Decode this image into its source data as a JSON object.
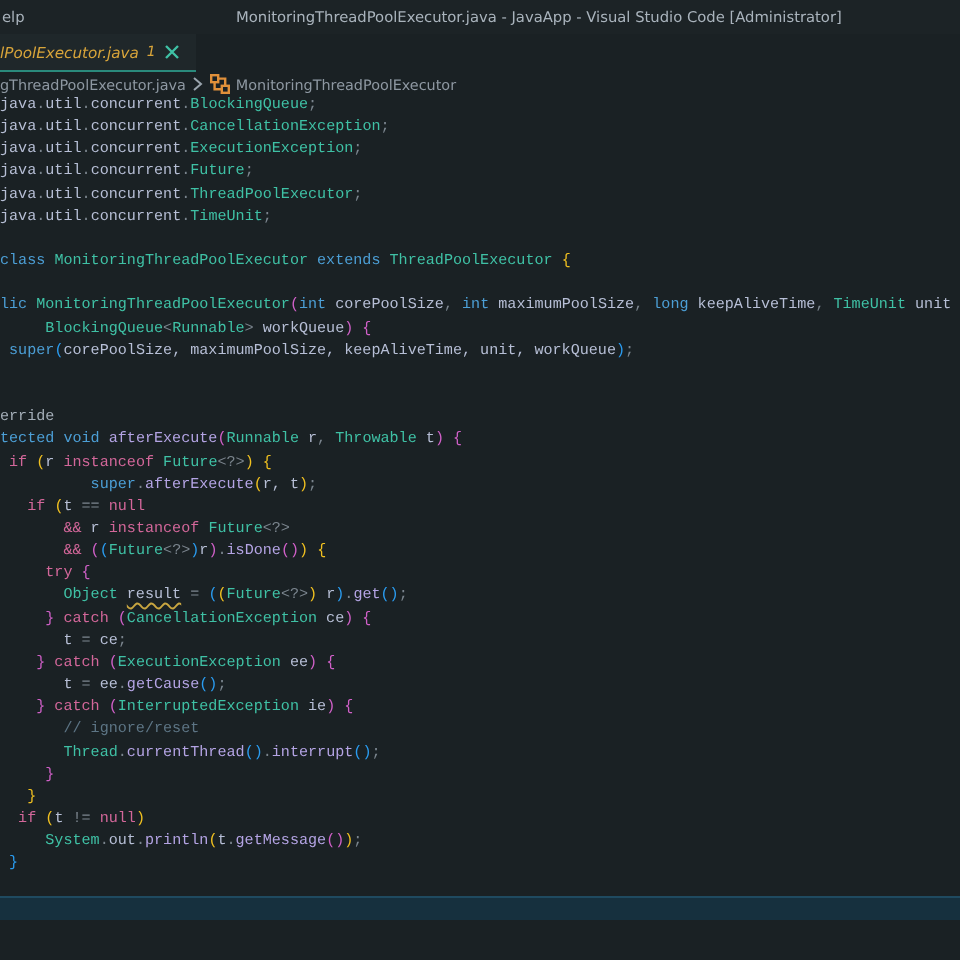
{
  "title_bar": {
    "menu_items": [
      "elp"
    ],
    "title": "MonitoringThreadPoolExecutor.java - JavaApp - Visual Studio Code [Administrator]"
  },
  "tabs": [
    {
      "label": "lPoolExecutor.java",
      "problems": "1",
      "selected": true
    }
  ],
  "breadcrumb": {
    "file": "gThreadPoolExecutor.java",
    "symbol": "MonitoringThreadPoolExecutor"
  },
  "code_lines": [
    {
      "tokens": [
        {
          "kind": "identifier",
          "text": "java"
        },
        {
          "kind": "punctuation",
          "text": "."
        },
        {
          "kind": "identifier",
          "text": "util"
        },
        {
          "kind": "punctuation",
          "text": "."
        },
        {
          "kind": "identifier",
          "text": "concurrent"
        },
        {
          "kind": "punctuation",
          "text": "."
        },
        {
          "kind": "type",
          "text": "BlockingQueue"
        },
        {
          "kind": "punctuation",
          "text": ";"
        }
      ]
    },
    {
      "tokens": [
        {
          "kind": "identifier",
          "text": "java"
        },
        {
          "kind": "punctuation",
          "text": "."
        },
        {
          "kind": "identifier",
          "text": "util"
        },
        {
          "kind": "punctuation",
          "text": "."
        },
        {
          "kind": "identifier",
          "text": "concurrent"
        },
        {
          "kind": "punctuation",
          "text": "."
        },
        {
          "kind": "type",
          "text": "CancellationException"
        },
        {
          "kind": "punctuation",
          "text": ";"
        }
      ]
    },
    {
      "tokens": [
        {
          "kind": "identifier",
          "text": "java"
        },
        {
          "kind": "punctuation",
          "text": "."
        },
        {
          "kind": "identifier",
          "text": "util"
        },
        {
          "kind": "punctuation",
          "text": "."
        },
        {
          "kind": "identifier",
          "text": "concurrent"
        },
        {
          "kind": "punctuation",
          "text": "."
        },
        {
          "kind": "type",
          "text": "ExecutionException"
        },
        {
          "kind": "punctuation",
          "text": ";"
        }
      ]
    },
    {
      "tokens": [
        {
          "kind": "identifier",
          "text": "java"
        },
        {
          "kind": "punctuation",
          "text": "."
        },
        {
          "kind": "identifier",
          "text": "util"
        },
        {
          "kind": "punctuation",
          "text": "."
        },
        {
          "kind": "identifier",
          "text": "concurrent"
        },
        {
          "kind": "punctuation",
          "text": "."
        },
        {
          "kind": "type",
          "text": "Future"
        },
        {
          "kind": "punctuation",
          "text": ";"
        }
      ]
    },
    {
      "tokens": [
        {
          "kind": "identifier",
          "text": "java"
        },
        {
          "kind": "punctuation",
          "text": "."
        },
        {
          "kind": "identifier",
          "text": "util"
        },
        {
          "kind": "punctuation",
          "text": "."
        },
        {
          "kind": "identifier",
          "text": "concurrent"
        },
        {
          "kind": "punctuation",
          "text": "."
        },
        {
          "kind": "type",
          "text": "ThreadPoolExecutor"
        },
        {
          "kind": "punctuation",
          "text": ";"
        }
      ]
    },
    {
      "tokens": [
        {
          "kind": "identifier",
          "text": "java"
        },
        {
          "kind": "punctuation",
          "text": "."
        },
        {
          "kind": "identifier",
          "text": "util"
        },
        {
          "kind": "punctuation",
          "text": "."
        },
        {
          "kind": "identifier",
          "text": "concurrent"
        },
        {
          "kind": "punctuation",
          "text": "."
        },
        {
          "kind": "type",
          "text": "TimeUnit"
        },
        {
          "kind": "punctuation",
          "text": ";"
        }
      ]
    },
    {
      "kind": "blank"
    },
    {
      "tokens": [
        {
          "kind": "storage",
          "text": "class "
        },
        {
          "kind": "type",
          "text": "MonitoringThreadPoolExecutor"
        },
        {
          "kind": "storage",
          "text": " extends "
        },
        {
          "kind": "type",
          "text": "ThreadPoolExecutor"
        },
        {
          "kind": "bracket-gold",
          "text": " {"
        }
      ]
    },
    {
      "kind": "blank"
    },
    {
      "tokens": [
        {
          "kind": "storage",
          "text": "lic "
        },
        {
          "kind": "type",
          "text": "MonitoringThreadPoolExecutor"
        },
        {
          "kind": "bracket-violet",
          "text": "("
        },
        {
          "kind": "storage",
          "text": "int "
        },
        {
          "kind": "identifier",
          "text": "corePoolSize"
        },
        {
          "kind": "punctuation",
          "text": ", "
        },
        {
          "kind": "storage",
          "text": "int "
        },
        {
          "kind": "identifier",
          "text": "maximumPoolSize"
        },
        {
          "kind": "punctuation",
          "text": ", "
        },
        {
          "kind": "storage",
          "text": "long "
        },
        {
          "kind": "identifier",
          "text": "keepAliveTime"
        },
        {
          "kind": "punctuation",
          "text": ", "
        },
        {
          "kind": "type",
          "text": "TimeUnit "
        },
        {
          "kind": "identifier",
          "text": "unit"
        }
      ]
    },
    {
      "tokens": [
        {
          "kind": "type",
          "text": "     BlockingQueue"
        },
        {
          "kind": "punctuation",
          "text": "<"
        },
        {
          "kind": "type",
          "text": "Runnable"
        },
        {
          "kind": "punctuation",
          "text": ">"
        },
        {
          "kind": "identifier",
          "text": " workQueue"
        },
        {
          "kind": "bracket-violet",
          "text": ")"
        },
        {
          "kind": "bracket-violet",
          "text": " {"
        }
      ]
    },
    {
      "tokens": [
        {
          "kind": "storage",
          "text": " super"
        },
        {
          "kind": "bracket-blue",
          "text": "("
        },
        {
          "kind": "identifier",
          "text": "corePoolSize, maximumPoolSize, keepAliveTime, unit, workQueue"
        },
        {
          "kind": "bracket-blue",
          "text": ")"
        },
        {
          "kind": "punctuation",
          "text": ";"
        }
      ]
    },
    {
      "kind": "blank"
    },
    {
      "kind": "blank"
    },
    {
      "tokens": [
        {
          "kind": "annotation",
          "text": "erride"
        }
      ]
    },
    {
      "tokens": [
        {
          "kind": "storage",
          "text": "tected void "
        },
        {
          "kind": "method",
          "text": "afterExecute"
        },
        {
          "kind": "bracket-violet",
          "text": "("
        },
        {
          "kind": "type",
          "text": "Runnable"
        },
        {
          "kind": "identifier",
          "text": " r"
        },
        {
          "kind": "punctuation",
          "text": ", "
        },
        {
          "kind": "type",
          "text": "Throwable"
        },
        {
          "kind": "identifier",
          "text": " t"
        },
        {
          "kind": "bracket-violet",
          "text": ")"
        },
        {
          "kind": "bracket-violet",
          "text": " {"
        }
      ]
    },
    {
      "tokens": [
        {
          "kind": "keyword",
          "text": " if "
        },
        {
          "kind": "bracket-gold",
          "text": "("
        },
        {
          "kind": "identifier",
          "text": "r"
        },
        {
          "kind": "keyword",
          "text": " instanceof "
        },
        {
          "kind": "type",
          "text": "Future"
        },
        {
          "kind": "punctuation",
          "text": "<?>"
        },
        {
          "kind": "bracket-gold",
          "text": ")"
        },
        {
          "kind": "bracket-gold",
          "text": " {"
        }
      ]
    },
    {
      "tokens": [
        {
          "kind": "storage",
          "text": "          super"
        },
        {
          "kind": "punctuation",
          "text": "."
        },
        {
          "kind": "method",
          "text": "afterExecute"
        },
        {
          "kind": "bracket-gold",
          "text": "("
        },
        {
          "kind": "identifier",
          "text": "r, t"
        },
        {
          "kind": "bracket-gold",
          "text": ")"
        },
        {
          "kind": "punctuation",
          "text": ";"
        }
      ]
    },
    {
      "tokens": [
        {
          "kind": "keyword",
          "text": "   if "
        },
        {
          "kind": "bracket-gold",
          "text": "("
        },
        {
          "kind": "identifier",
          "text": "t"
        },
        {
          "kind": "punctuation",
          "text": " == "
        },
        {
          "kind": "keyword",
          "text": "null"
        }
      ]
    },
    {
      "tokens": [
        {
          "kind": "keyword",
          "text": "       &&"
        },
        {
          "kind": "identifier",
          "text": " r"
        },
        {
          "kind": "keyword",
          "text": " instanceof "
        },
        {
          "kind": "type",
          "text": "Future"
        },
        {
          "kind": "punctuation",
          "text": "<?>"
        }
      ]
    },
    {
      "tokens": [
        {
          "kind": "keyword",
          "text": "       && "
        },
        {
          "kind": "bracket-violet",
          "text": "("
        },
        {
          "kind": "bracket-blue",
          "text": "("
        },
        {
          "kind": "type",
          "text": "Future"
        },
        {
          "kind": "punctuation",
          "text": "<?>"
        },
        {
          "kind": "bracket-blue",
          "text": ")"
        },
        {
          "kind": "identifier",
          "text": "r"
        },
        {
          "kind": "bracket-violet",
          "text": ")"
        },
        {
          "kind": "punctuation",
          "text": "."
        },
        {
          "kind": "method",
          "text": "isDone"
        },
        {
          "kind": "bracket-violet",
          "text": "()"
        },
        {
          "kind": "bracket-gold",
          "text": ")"
        },
        {
          "kind": "bracket-gold",
          "text": " {"
        }
      ]
    },
    {
      "tokens": [
        {
          "kind": "keyword",
          "text": "     try "
        },
        {
          "kind": "bracket-violet",
          "text": "{"
        }
      ]
    },
    {
      "tokens": [
        {
          "kind": "type",
          "text": "       Object "
        },
        {
          "kind": "warning-identifier",
          "text": "result"
        },
        {
          "kind": "punctuation",
          "text": " = "
        },
        {
          "kind": "bracket-blue",
          "text": "("
        },
        {
          "kind": "bracket-gold",
          "text": "("
        },
        {
          "kind": "type",
          "text": "Future"
        },
        {
          "kind": "punctuation",
          "text": "<?>"
        },
        {
          "kind": "bracket-gold",
          "text": ")"
        },
        {
          "kind": "identifier",
          "text": " r"
        },
        {
          "kind": "bracket-blue",
          "text": ")"
        },
        {
          "kind": "punctuation",
          "text": "."
        },
        {
          "kind": "method",
          "text": "get"
        },
        {
          "kind": "bracket-blue",
          "text": "()"
        },
        {
          "kind": "punctuation",
          "text": ";"
        }
      ]
    },
    {
      "tokens": [
        {
          "kind": "bracket-violet",
          "text": "     }"
        },
        {
          "kind": "keyword",
          "text": " catch "
        },
        {
          "kind": "bracket-violet",
          "text": "("
        },
        {
          "kind": "type",
          "text": "CancellationException"
        },
        {
          "kind": "identifier",
          "text": " ce"
        },
        {
          "kind": "bracket-violet",
          "text": ")"
        },
        {
          "kind": "bracket-violet",
          "text": " {"
        }
      ]
    },
    {
      "tokens": [
        {
          "kind": "identifier",
          "text": "       t"
        },
        {
          "kind": "punctuation",
          "text": " = "
        },
        {
          "kind": "identifier",
          "text": "ce"
        },
        {
          "kind": "punctuation",
          "text": ";"
        }
      ]
    },
    {
      "tokens": [
        {
          "kind": "bracket-violet",
          "text": "    }"
        },
        {
          "kind": "keyword",
          "text": " catch "
        },
        {
          "kind": "bracket-violet",
          "text": "("
        },
        {
          "kind": "type",
          "text": "ExecutionException"
        },
        {
          "kind": "identifier",
          "text": " ee"
        },
        {
          "kind": "bracket-violet",
          "text": ")"
        },
        {
          "kind": "bracket-violet",
          "text": " {"
        }
      ]
    },
    {
      "tokens": [
        {
          "kind": "identifier",
          "text": "       t"
        },
        {
          "kind": "punctuation",
          "text": " = "
        },
        {
          "kind": "identifier",
          "text": "ee"
        },
        {
          "kind": "punctuation",
          "text": "."
        },
        {
          "kind": "method",
          "text": "getCause"
        },
        {
          "kind": "bracket-blue",
          "text": "()"
        },
        {
          "kind": "punctuation",
          "text": ";"
        }
      ]
    },
    {
      "tokens": [
        {
          "kind": "bracket-violet",
          "text": "    }"
        },
        {
          "kind": "keyword",
          "text": " catch "
        },
        {
          "kind": "bracket-violet",
          "text": "("
        },
        {
          "kind": "type",
          "text": "InterruptedException"
        },
        {
          "kind": "identifier",
          "text": " ie"
        },
        {
          "kind": "bracket-violet",
          "text": ")"
        },
        {
          "kind": "bracket-violet",
          "text": " {"
        }
      ]
    },
    {
      "tokens": [
        {
          "kind": "comment",
          "text": "       // ignore/reset"
        }
      ]
    },
    {
      "tokens": [
        {
          "kind": "type",
          "text": "       Thread"
        },
        {
          "kind": "punctuation",
          "text": "."
        },
        {
          "kind": "method",
          "text": "currentThread"
        },
        {
          "kind": "bracket-blue",
          "text": "()"
        },
        {
          "kind": "punctuation",
          "text": "."
        },
        {
          "kind": "method",
          "text": "interrupt"
        },
        {
          "kind": "bracket-blue",
          "text": "()"
        },
        {
          "kind": "punctuation",
          "text": ";"
        }
      ]
    },
    {
      "tokens": [
        {
          "kind": "bracket-violet",
          "text": "     }"
        }
      ]
    },
    {
      "tokens": [
        {
          "kind": "bracket-gold",
          "text": "   }"
        }
      ]
    },
    {
      "tokens": [
        {
          "kind": "keyword",
          "text": "  if "
        },
        {
          "kind": "bracket-gold",
          "text": "("
        },
        {
          "kind": "identifier",
          "text": "t"
        },
        {
          "kind": "punctuation",
          "text": " != "
        },
        {
          "kind": "keyword",
          "text": "null"
        },
        {
          "kind": "bracket-gold",
          "text": ")"
        }
      ]
    },
    {
      "tokens": [
        {
          "kind": "type",
          "text": "     System"
        },
        {
          "kind": "punctuation",
          "text": "."
        },
        {
          "kind": "identifier",
          "text": "out"
        },
        {
          "kind": "punctuation",
          "text": "."
        },
        {
          "kind": "method",
          "text": "println"
        },
        {
          "kind": "bracket-gold",
          "text": "("
        },
        {
          "kind": "identifier",
          "text": "t"
        },
        {
          "kind": "punctuation",
          "text": "."
        },
        {
          "kind": "method",
          "text": "getMessage"
        },
        {
          "kind": "bracket-violet",
          "text": "()"
        },
        {
          "kind": "bracket-gold",
          "text": ")"
        },
        {
          "kind": "punctuation",
          "text": ";"
        }
      ]
    },
    {
      "tokens": [
        {
          "kind": "bracket-blue",
          "text": " }"
        }
      ]
    }
  ]
}
